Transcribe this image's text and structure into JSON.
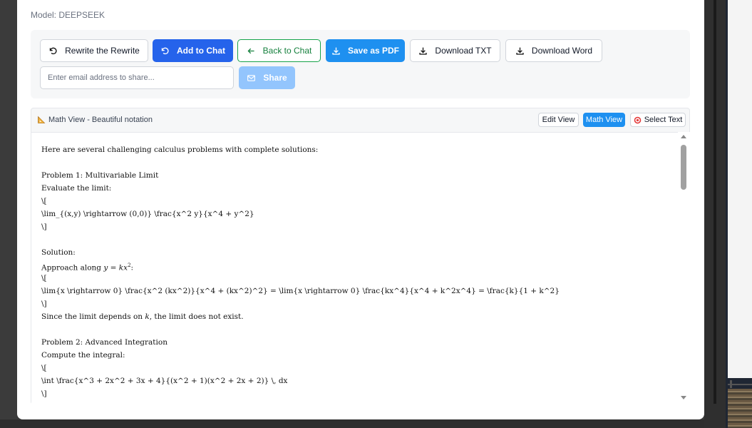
{
  "header": {
    "model_label": "Model: DEEPSEEK"
  },
  "toolbar": {
    "rewrite_label": "Rewrite the Rewrite",
    "add_to_chat_label": "Add to Chat",
    "back_to_chat_label": "Back to Chat",
    "save_pdf_label": "Save as PDF",
    "download_txt_label": "Download TXT",
    "download_word_label": "Download Word",
    "email_placeholder": "Enter email address to share...",
    "email_value": "",
    "share_label": "Share"
  },
  "viewer": {
    "title": "Math View - Beautiful notation",
    "edit_view_label": "Edit View",
    "math_view_label": "Math View",
    "select_text_label": "Select Text",
    "active_view": "Math View"
  },
  "content": {
    "lines": [
      "Here are several challenging calculus problems with complete solutions:",
      "",
      "Problem 1: Multivariable Limit",
      "Evaluate the limit:",
      "\\[",
      "\\lim_{(x,y) \\rightarrow (0,0)} \\frac{x^2 y}{x^4 + y^2}",
      "\\]",
      "",
      "Solution:",
      "Approach along y = kx²:",
      "\\[",
      "\\lim{x \\rightarrow 0} \\frac{x^2 (kx^2)}{x^4 + (kx^2)^2} = \\lim{x \\rightarrow 0} \\frac{kx^4}{x^4 + k^2x^4} = \\frac{k}{1 + k^2}",
      "\\]",
      "Since the limit depends on k, the limit does not exist.",
      "",
      "Problem 2: Advanced Integration",
      "Compute the integral:",
      "\\[",
      "\\int \\frac{x^3 + 2x^2 + 3x + 4}{(x^2 + 1)(x^2 + 2x + 2)} \\, dx",
      "\\]"
    ],
    "inline_math": {
      "approach_prefix": "Approach along ",
      "approach_math": "y = kx",
      "approach_exp": "2",
      "approach_suffix": ":",
      "since_prefix": "Since the limit depends on ",
      "since_math": "k",
      "since_suffix": ", the limit does not exist."
    }
  },
  "colors": {
    "primary_blue": "#2563eb",
    "sky_blue": "#1e90f0",
    "success_green": "#16a34a",
    "disabled_blue": "#93c5fd"
  }
}
